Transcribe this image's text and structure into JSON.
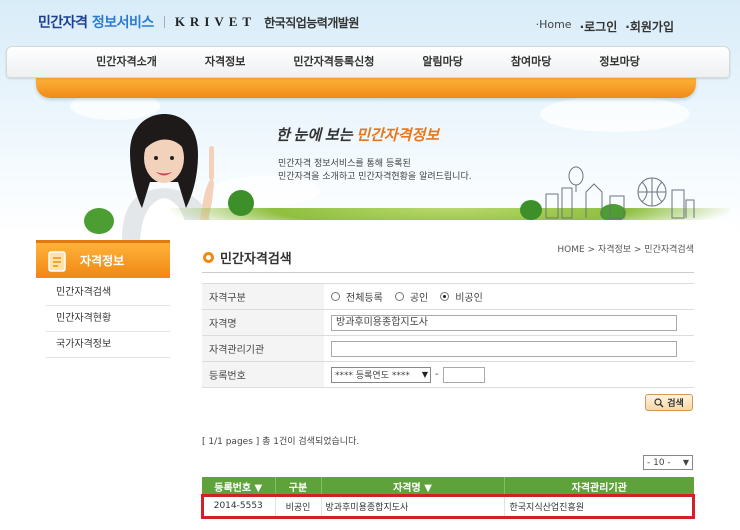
{
  "header": {
    "logo_main": "민간자격",
    "logo_accent": "정보서비스",
    "logo_krivet": "KRIVET",
    "logo_org": "한국직업능력개발원",
    "links": [
      "·Home",
      "·로그인",
      "·회원가입"
    ]
  },
  "nav": {
    "items": [
      "민간자격소개",
      "자격정보",
      "민간자격등록신청",
      "알림마당",
      "참여마당",
      "정보마당"
    ]
  },
  "banner": {
    "title_plain": "한 눈에 보는",
    "title_accent": "민간자격정보",
    "sub_line1": "민간자격 정보서비스를 통해 등록된",
    "sub_line2": "민간자격을 소개하고 민간자격현황을 알려드립니다."
  },
  "sidebar": {
    "title": "자격정보",
    "items": [
      "민간자격검색",
      "민간자격현황",
      "국가자격정보"
    ]
  },
  "page": {
    "title": "민간자격검색",
    "breadcrumb": "HOME > 자격정보 > 민간자격검색"
  },
  "form": {
    "type_label": "자격구분",
    "type_options": [
      "전체등록",
      "공인",
      "비공인"
    ],
    "type_selected": "비공인",
    "name_label": "자격명",
    "name_value": "방과후미용종합지도사",
    "org_label": "자격관리기관",
    "org_value": "",
    "regno_label": "등록번호",
    "regno_year_select": "**** 등록연도 ****",
    "regno_dash": "-",
    "regno_value": "",
    "search_button": "검색"
  },
  "results": {
    "summary": "[ 1/1 pages ] 총 1건이 검색되었습니다.",
    "per_page": "- 10 -",
    "columns": [
      "등록번호 ▼",
      "구분",
      "자격명 ▼",
      "자격관리기관"
    ],
    "rows": [
      [
        "2014-5553",
        "비공인",
        "방과후미용종합지도사",
        "한국지식산업진흥원"
      ]
    ]
  },
  "colors": {
    "accent_orange": "#f08a17",
    "header_green": "#5fa23c",
    "highlight_red": "#d0202a",
    "brand_blue": "#1c3f95"
  }
}
